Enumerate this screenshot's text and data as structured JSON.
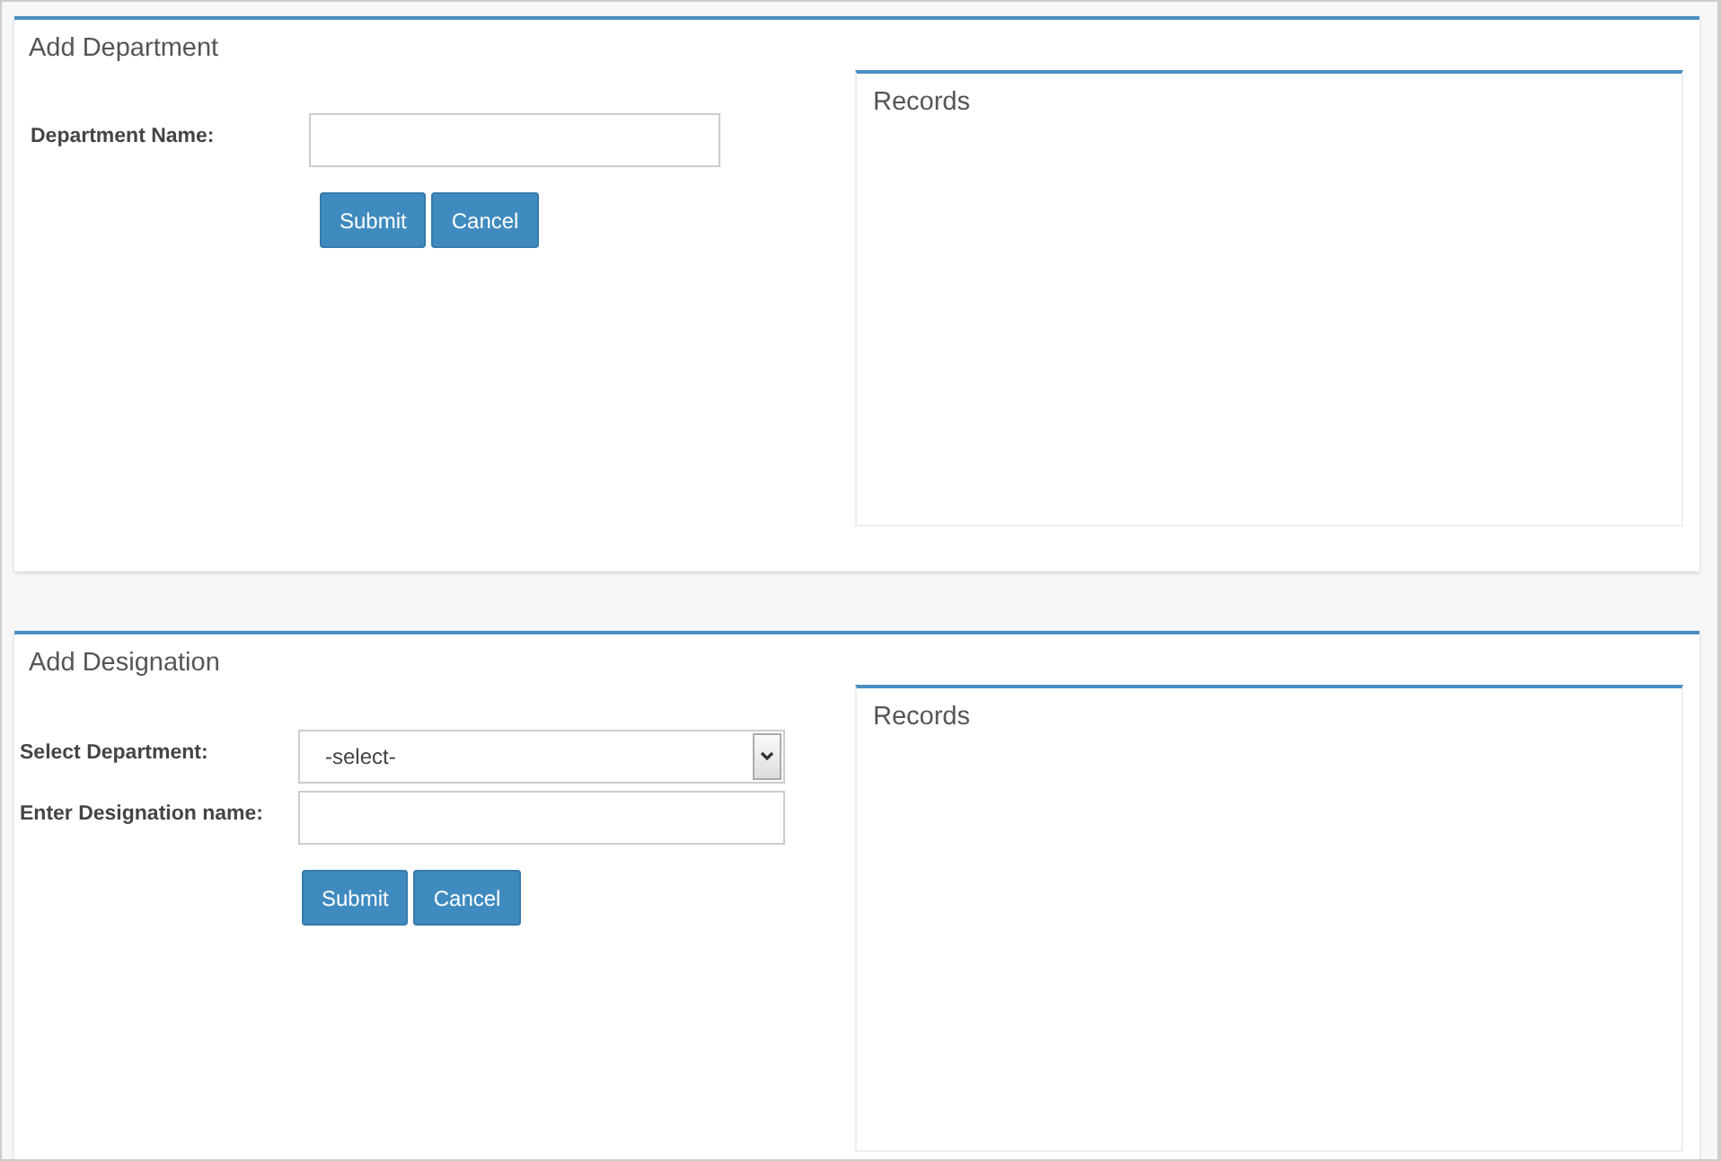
{
  "sections": [
    {
      "title": "Add Department",
      "fields": [
        {
          "kind": "text",
          "label": "Department Name:"
        }
      ],
      "buttons": [
        "Submit",
        "Cancel"
      ],
      "records": {
        "title": "Records"
      }
    },
    {
      "title": "Add Designation",
      "fields": [
        {
          "kind": "select",
          "label": "Select Department:",
          "value": "-select-"
        },
        {
          "kind": "text",
          "label": "Enter Designation name:"
        }
      ],
      "buttons": [
        "Submit",
        "Cancel"
      ],
      "records": {
        "title": "Records"
      }
    }
  ]
}
